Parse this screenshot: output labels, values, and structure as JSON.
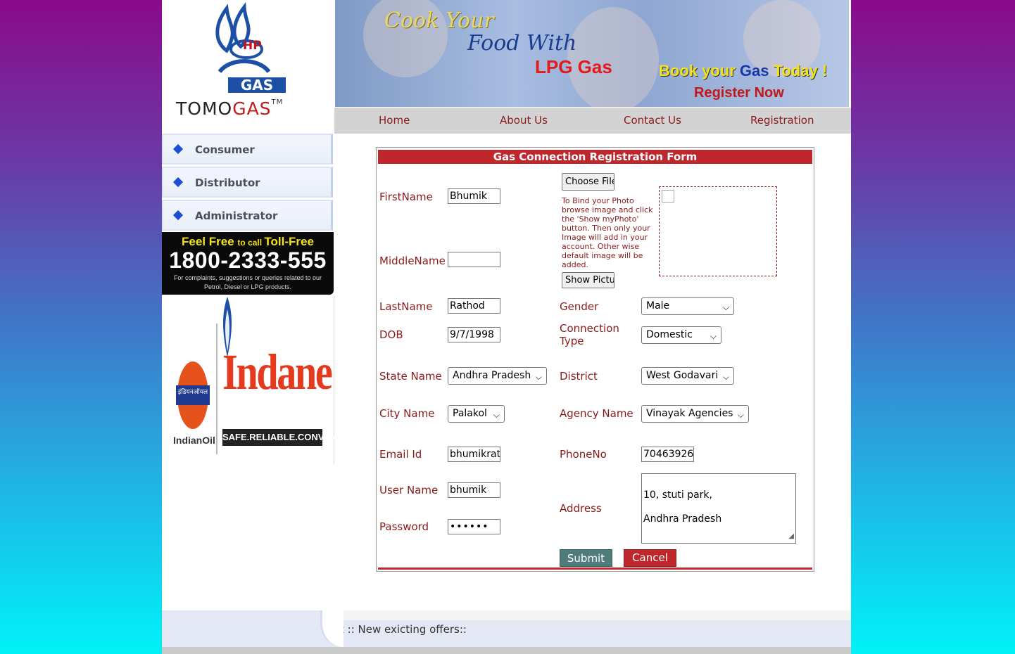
{
  "brand": {
    "hp_text": "HP",
    "gas_text": "GAS",
    "tomogas_a": "TOMO",
    "tomogas_b": "GAS",
    "trademark": "TM"
  },
  "banner": {
    "line1": "Cook Your",
    "line2": "Food With",
    "line3": "LPG Gas",
    "book_a": "Book your ",
    "book_gas": "Gas",
    "book_b": " Today !",
    "register": "Register Now"
  },
  "nav": {
    "items": [
      {
        "label": "Home"
      },
      {
        "label": "About Us"
      },
      {
        "label": "Contact Us"
      },
      {
        "label": "Registration"
      }
    ]
  },
  "sidebar": {
    "items": [
      {
        "label": "Consumer"
      },
      {
        "label": "Distributor"
      },
      {
        "label": "Administrator"
      }
    ]
  },
  "tollfree": {
    "head_a": "Feel Free ",
    "head_small": "to call ",
    "head_b": "Toll-Free",
    "number": "1800-2333-555",
    "sub": "For complaints, suggestions or queries related to our Petrol, Diesel or LPG products."
  },
  "indane": {
    "word": "Indane",
    "tagline": "SAFE.RELIABLE.CONVENIENT",
    "io_label": "IndianOil",
    "hindi": "इंडियनऑयल"
  },
  "form": {
    "title": "Gas Connection Registration Form",
    "labels": {
      "firstname": "FirstName",
      "middlename": "MiddleName",
      "lastname": "LastName",
      "dob": "DOB",
      "state": "State Name",
      "city": "City Name",
      "email": "Email Id",
      "username": "User Name",
      "password": "Password",
      "gender": "Gender",
      "connection_a": "Connection",
      "connection_b": "Type",
      "district": "District",
      "agency": "Agency Name",
      "phone": "PhoneNo",
      "address": "Address"
    },
    "values": {
      "firstname": "Bhumik",
      "middlename": "",
      "lastname": "Rathod",
      "dob": "9/7/1998",
      "state": "Andhra Pradesh",
      "city": "Palakol",
      "email": "bhumikrat",
      "username": "bhumik",
      "password": "••••••",
      "gender": "Male",
      "connection": "Domestic",
      "district": "West Godavari",
      "agency": "Vinayak Agencies",
      "phone": "70463926",
      "address_line1": "10, stuti park,",
      "address_line2": "Andhra Pradesh"
    },
    "choose_file": "Choose File",
    "show_picture": "Show Picture",
    "photo_note": "To Bind your Photo browse image and click the 'Show myPhoto' button. Then only your Image will add in your account. Other wise default image will be added.",
    "submit": "Submit",
    "cancel": "Cancel"
  },
  "footer": {
    "marquee": "t :: New exicting offers::"
  },
  "colors": {
    "accent_red": "#c0272d",
    "label_red": "#8b1a1a",
    "submit_teal": "#4f7c7a",
    "nav_gray": "#d3d3d3"
  }
}
